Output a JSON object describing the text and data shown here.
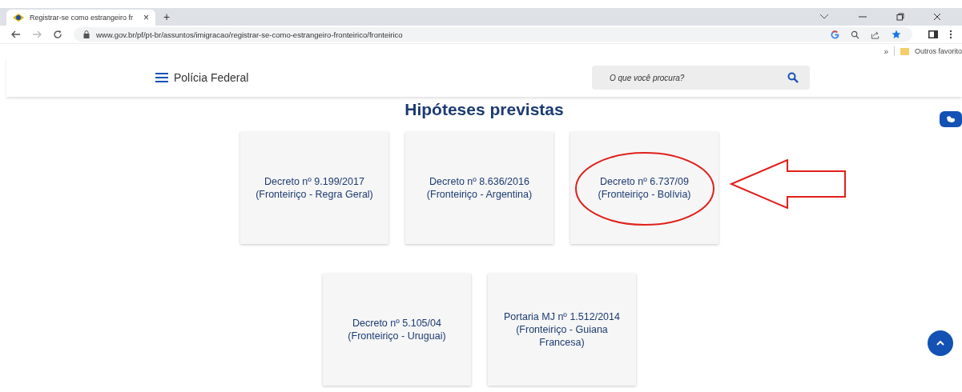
{
  "browser": {
    "tab_title": "Registrar-se como estrangeiro fr",
    "tab_close": "×",
    "new_tab": "+",
    "url": "www.gov.br/pf/pt-br/assuntos/imigracao/registrar-se-como-estrangeiro-fronteirico/fronteirico",
    "bookmarks_more": "»",
    "bookmark_folder": "Outros favorito"
  },
  "header": {
    "site_name": "Polícia Federal",
    "search": {
      "placeholder": "O que você procura?"
    }
  },
  "heading": "Hipóteses previstas",
  "card_rows": [
    [
      {
        "text": "Decreto nº 9.199/2017 (Fronteiriço - Regra Geral)",
        "highlighted": false
      },
      {
        "text": "Decreto nº 8.636/2016 (Fronteiriço - Argentina)",
        "highlighted": false
      },
      {
        "text": "Decreto nº 6.737/09 (Fronteiriço - Bolívia)",
        "highlighted": true
      }
    ],
    [
      {
        "text": "Decreto nº 5.105/04 (Fronteiriço - Uruguai)",
        "highlighted": false
      },
      {
        "text": "Portaria MJ nº 1.512/2014 (Fronteiriço - Guiana Francesa)",
        "highlighted": false
      }
    ]
  ]
}
